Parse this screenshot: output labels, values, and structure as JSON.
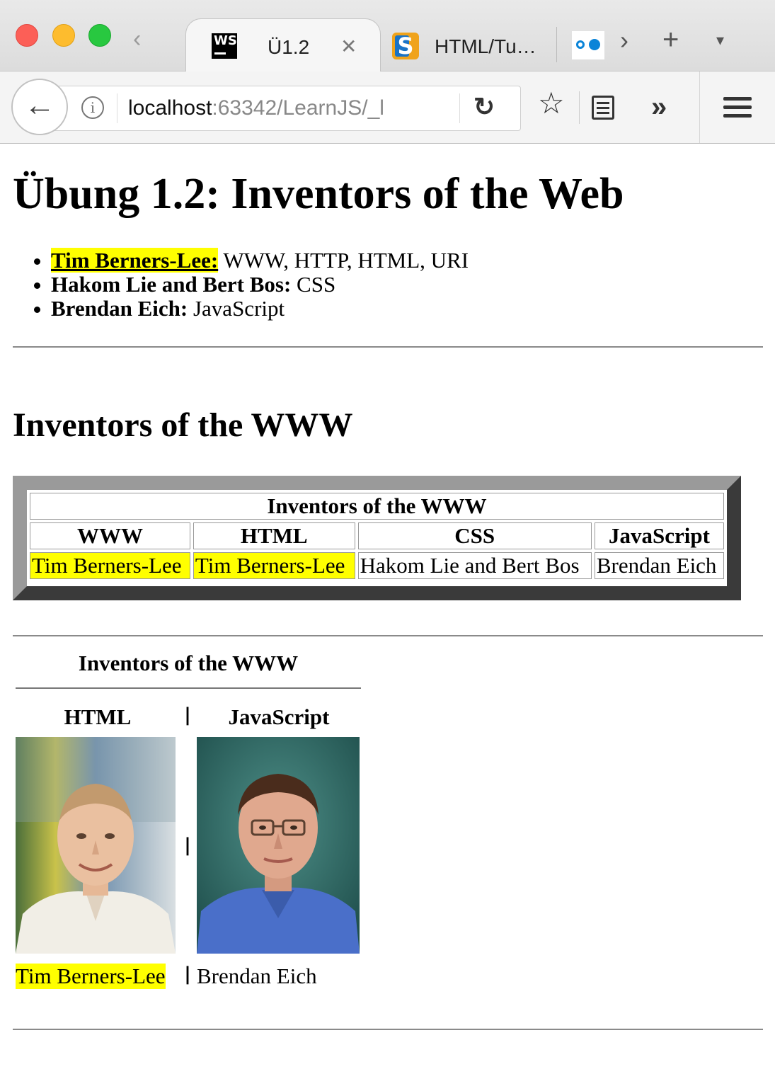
{
  "browser": {
    "tabs": [
      {
        "icon": "ws-icon",
        "title": "Ü1.2",
        "close": "✕",
        "active": true
      },
      {
        "icon": "s-icon",
        "title": "HTML/Tu…",
        "active": false
      }
    ],
    "url": {
      "host": "localhost",
      "rest": ":63342/LearnJS/_l"
    }
  },
  "page": {
    "title": "Übung 1.2: Inventors of the Web",
    "list": [
      {
        "name": "Tim Berners-Lee:",
        "desc": " WWW, HTTP, HTML, URI",
        "highlight": "#ffff00"
      },
      {
        "name": "Hakom Lie and Bert Bos:",
        "desc": " CSS"
      },
      {
        "name": "Brendan Eich:",
        "desc": " JavaScript"
      }
    ],
    "section_heading": "Inventors of the WWW",
    "table1": {
      "caption": "Inventors of the WWW",
      "headers": [
        "WWW",
        "HTML",
        "CSS",
        "JavaScript"
      ],
      "row": [
        "Tim Berners-Lee",
        "Tim Berners-Lee",
        "Hakom Lie and Bert Bos",
        "Brendan Eich"
      ]
    },
    "table2": {
      "caption": "Inventors of the WWW",
      "headers": [
        "HTML",
        "JavaScript"
      ],
      "separator": "|",
      "names": [
        "Tim Berners-Lee",
        "Brendan Eich"
      ]
    }
  }
}
